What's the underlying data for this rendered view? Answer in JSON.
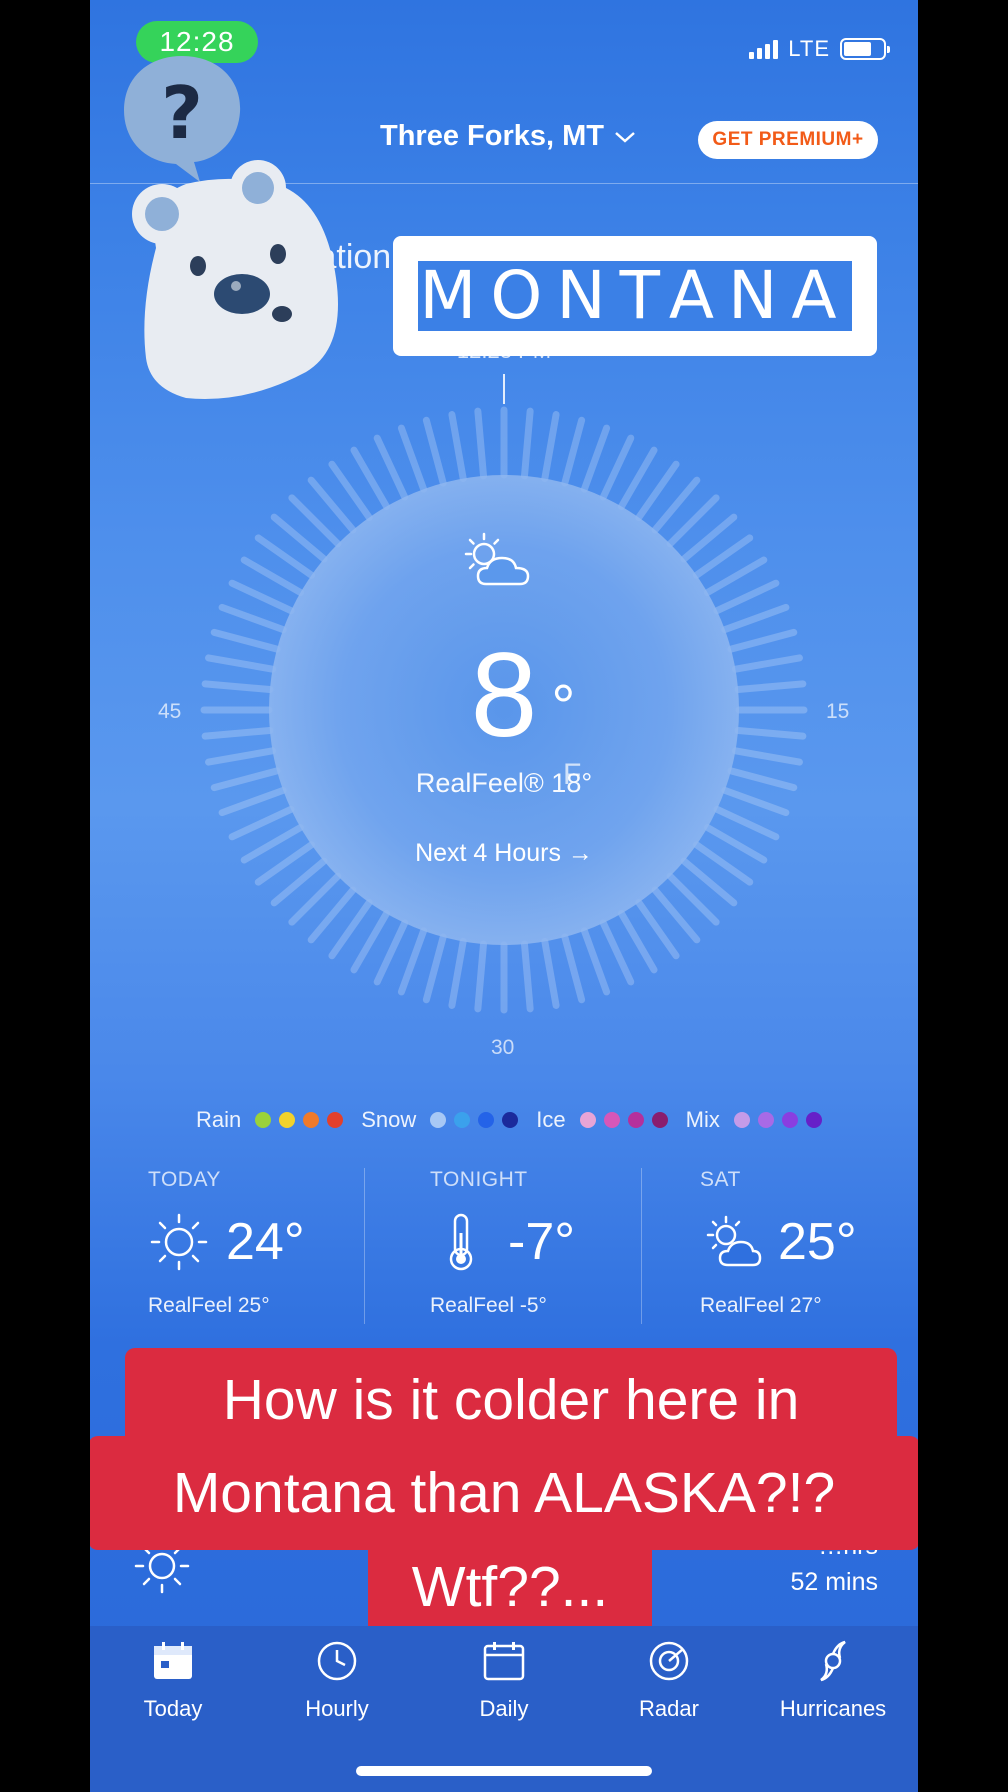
{
  "status": {
    "time": "12:28",
    "network": "LTE"
  },
  "header": {
    "location": "Three Forks, MT",
    "premium_label": "GET PREMIUM+"
  },
  "nowcast": {
    "precip_text": "…ipitation for at least 60 min",
    "time_marker": "12:28 PM"
  },
  "sticker": {
    "text": "MONTANA"
  },
  "dial": {
    "left_label": "45",
    "right_label": "15",
    "bottom_label": "30"
  },
  "current": {
    "temp": "8",
    "degree": "°",
    "unit": "F",
    "realfeel": "RealFeel® 18°",
    "next_hours": "Next 4 Hours →",
    "icon": "partly-sunny-icon"
  },
  "legend": [
    {
      "label": "Rain",
      "colors": [
        "#9ad23a",
        "#f2d22c",
        "#ef7a2a",
        "#e2402c"
      ]
    },
    {
      "label": "Snow",
      "colors": [
        "#a7c8f5",
        "#3ba1ec",
        "#2463e8",
        "#1b2a9c"
      ]
    },
    {
      "label": "Ice",
      "colors": [
        "#e8a4d6",
        "#d657b8",
        "#b5309c",
        "#8a1d6e"
      ]
    },
    {
      "label": "Mix",
      "colors": [
        "#c49be8",
        "#a86ae6",
        "#8a3ee0",
        "#6620c8"
      ]
    }
  ],
  "forecast": [
    {
      "label": "TODAY",
      "temp": "24°",
      "realfeel": "RealFeel 25°",
      "icon": "sun-icon"
    },
    {
      "label": "TONIGHT",
      "temp": "-7°",
      "realfeel": "RealFeel -5°",
      "icon": "thermometer-icon"
    },
    {
      "label": "SAT",
      "temp": "25°",
      "realfeel": "RealFeel 27°",
      "icon": "partly-sunny-icon"
    }
  ],
  "daylight": {
    "line1": "…hrs",
    "line2": "52 mins"
  },
  "caption": {
    "line1": "How is it colder here in",
    "line2": "Montana than ALASKA?!?",
    "line3": "Wtf??..."
  },
  "tabs": [
    {
      "label": "Today",
      "icon": "calendar-today-icon"
    },
    {
      "label": "Hourly",
      "icon": "clock-icon"
    },
    {
      "label": "Daily",
      "icon": "calendar-icon"
    },
    {
      "label": "Radar",
      "icon": "radar-icon"
    },
    {
      "label": "Hurricanes",
      "icon": "hurricane-icon"
    }
  ]
}
